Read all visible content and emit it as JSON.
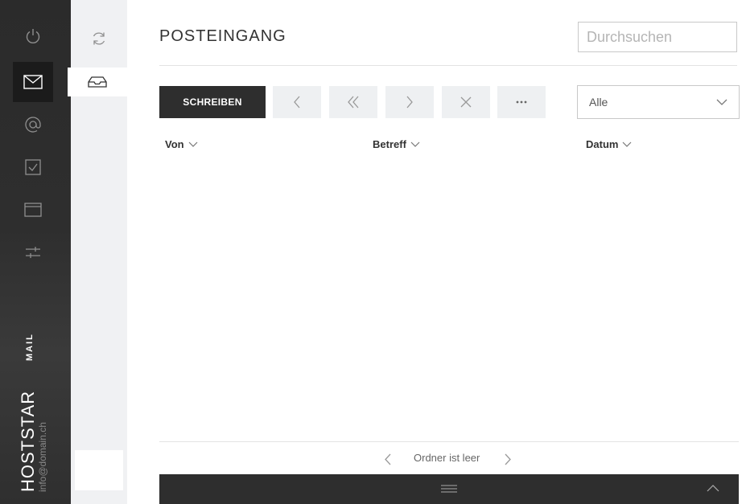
{
  "app": {
    "brand_logo": "HOSTSTAR",
    "brand_product": "MAIL",
    "account_email": "info@domain.ch"
  },
  "rail": {
    "items": [
      {
        "name": "power",
        "icon": "power-icon",
        "active": false
      },
      {
        "name": "mail",
        "icon": "envelope-icon",
        "active": true
      },
      {
        "name": "contacts",
        "icon": "at-sign-icon",
        "active": false
      },
      {
        "name": "tasks",
        "icon": "checkbox-icon",
        "active": false
      },
      {
        "name": "calendar",
        "icon": "calendar-icon",
        "active": false
      },
      {
        "name": "settings",
        "icon": "sliders-icon",
        "active": false
      }
    ]
  },
  "folders": {
    "sync_icon": "refresh-icon",
    "selected_icon": "inbox-tray-icon"
  },
  "header": {
    "title": "POSTEINGANG",
    "search_placeholder": "Durchsuchen"
  },
  "toolbar": {
    "compose_label": "SCHREIBEN",
    "icons": [
      "chevron-left-icon",
      "double-chevron-left-icon",
      "chevron-right-icon",
      "close-icon",
      "more-dots-icon"
    ],
    "filter_value": "Alle"
  },
  "list": {
    "columns": [
      "Von",
      "Betreff",
      "Datum"
    ],
    "rows": []
  },
  "pager": {
    "status": "Ordner ist leer"
  },
  "colors": {
    "rail_bg": "#2b2b2b",
    "rail_active": "#1b1b1b",
    "folders_bg": "#f0f1f3",
    "primary_button": "#2e2e2e",
    "toolbar_button": "#eef0f2"
  }
}
